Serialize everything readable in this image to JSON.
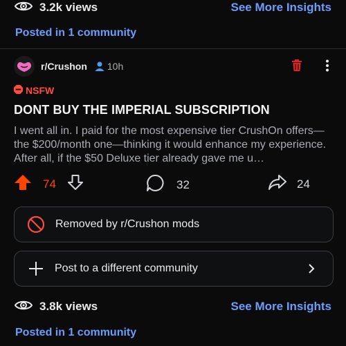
{
  "top": {
    "views": "3.2k views",
    "insights": "See More Insights",
    "posted_in": "Posted in 1 community"
  },
  "post": {
    "subreddit": "r/Crushon",
    "time": "10h",
    "nsfw": "NSFW",
    "title": "DONT BUY THE IMPERIAL SUBSCRIPTION",
    "body": "I went all in. I paid for the most expensive tier CrushOn offers—the $200/month one—thinking it would enhance my experience. After all, if the $50 Deluxe tier already gave me u…",
    "score": "74",
    "comments": "32",
    "shares": "24",
    "colors": {
      "upvote": "#ff4500",
      "nsfw": "#ff4c3b",
      "trash": "#e02424"
    }
  },
  "cards": {
    "removed": "Removed by r/Crushon mods",
    "crosspost": "Post to a different community"
  },
  "bottom": {
    "views": "3.8k views",
    "insights": "See More Insights",
    "posted_in": "Posted in 1 community"
  }
}
